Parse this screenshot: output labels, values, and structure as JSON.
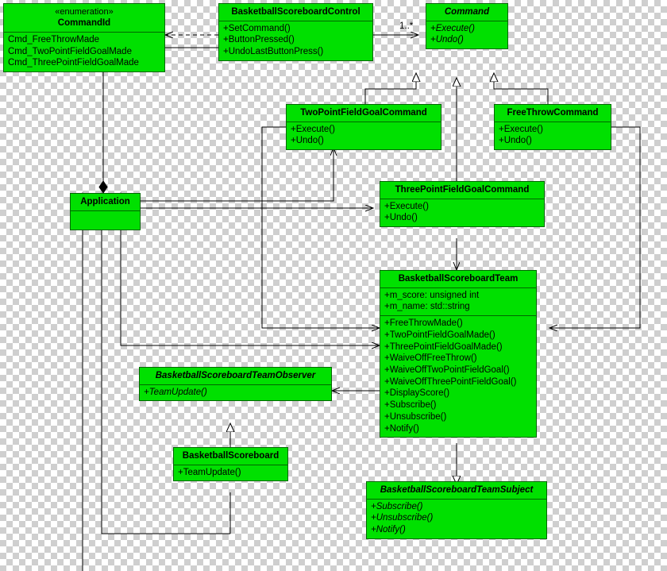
{
  "diagram": {
    "type": "uml-class-diagram",
    "accent_fill": "#00e000",
    "accent_border": "#006600",
    "classes": [
      {
        "id": "command-id",
        "stereotype": "«enumeration»",
        "name": "CommandId",
        "italic_name": false,
        "attributes": [
          "Cmd_FreeThrowMade",
          "Cmd_TwoPointFieldGoalMade",
          "Cmd_ThreePointFieldGoalMade"
        ],
        "operations": []
      },
      {
        "id": "basketball-scoreboard-control",
        "stereotype": "",
        "name": "BasketballScoreboardControl",
        "italic_name": false,
        "attributes": [],
        "operations": [
          "+SetCommand()",
          "+ButtonPressed()",
          "+UndoLastButtonPress()"
        ]
      },
      {
        "id": "command",
        "stereotype": "",
        "name": "Command",
        "italic_name": true,
        "attributes": [],
        "operations": [
          "+Execute()",
          "+Undo()"
        ],
        "italic_operations": true
      },
      {
        "id": "two-point-field-goal-command",
        "stereotype": "",
        "name": "TwoPointFieldGoalCommand",
        "italic_name": false,
        "attributes": [],
        "operations": [
          "+Execute()",
          "+Undo()"
        ]
      },
      {
        "id": "free-throw-command",
        "stereotype": "",
        "name": "FreeThrowCommand",
        "italic_name": false,
        "attributes": [],
        "operations": [
          "+Execute()",
          "+Undo()"
        ]
      },
      {
        "id": "three-point-field-goal-command",
        "stereotype": "",
        "name": "ThreePointFieldGoalCommand",
        "italic_name": false,
        "attributes": [],
        "operations": [
          "+Execute()",
          "+Undo()"
        ]
      },
      {
        "id": "application",
        "stereotype": "",
        "name": "Application",
        "italic_name": false,
        "attributes": [],
        "operations": []
      },
      {
        "id": "basketball-scoreboard-team",
        "stereotype": "",
        "name": "BasketballScoreboardTeam",
        "italic_name": false,
        "attributes": [
          "+m_score: unsigned int",
          "+m_name: std::string"
        ],
        "operations": [
          "+FreeThrowMade()",
          "+TwoPointFieldGoalMade()",
          "+ThreePointFieldGoalMade()",
          "+WaiveOffFreeThrow()",
          "+WaiveOffTwoPointFieldGoal()",
          "+WaiveOffThreePointFieldGoal()",
          "+DisplayScore()",
          "+Subscribe()",
          "+Unsubscribe()",
          "+Notify()"
        ]
      },
      {
        "id": "basketball-scoreboard-team-observer",
        "stereotype": "",
        "name": "BasketballScoreboardTeamObserver",
        "italic_name": true,
        "attributes": [],
        "operations": [
          "+TeamUpdate()"
        ],
        "italic_operations": true
      },
      {
        "id": "basketball-scoreboard",
        "stereotype": "",
        "name": "BasketballScoreboard",
        "italic_name": false,
        "attributes": [],
        "operations": [
          "+TeamUpdate()"
        ]
      },
      {
        "id": "basketball-scoreboard-team-subject",
        "stereotype": "",
        "name": "BasketballScoreboardTeamSubject",
        "italic_name": true,
        "attributes": [],
        "operations": [
          "+Subscribe()",
          "+Unsubscribe()",
          "+Notify()"
        ],
        "italic_operations": true
      }
    ],
    "edge_labels": [
      {
        "id": "command-multiplicity",
        "text": "1..*"
      }
    ]
  }
}
